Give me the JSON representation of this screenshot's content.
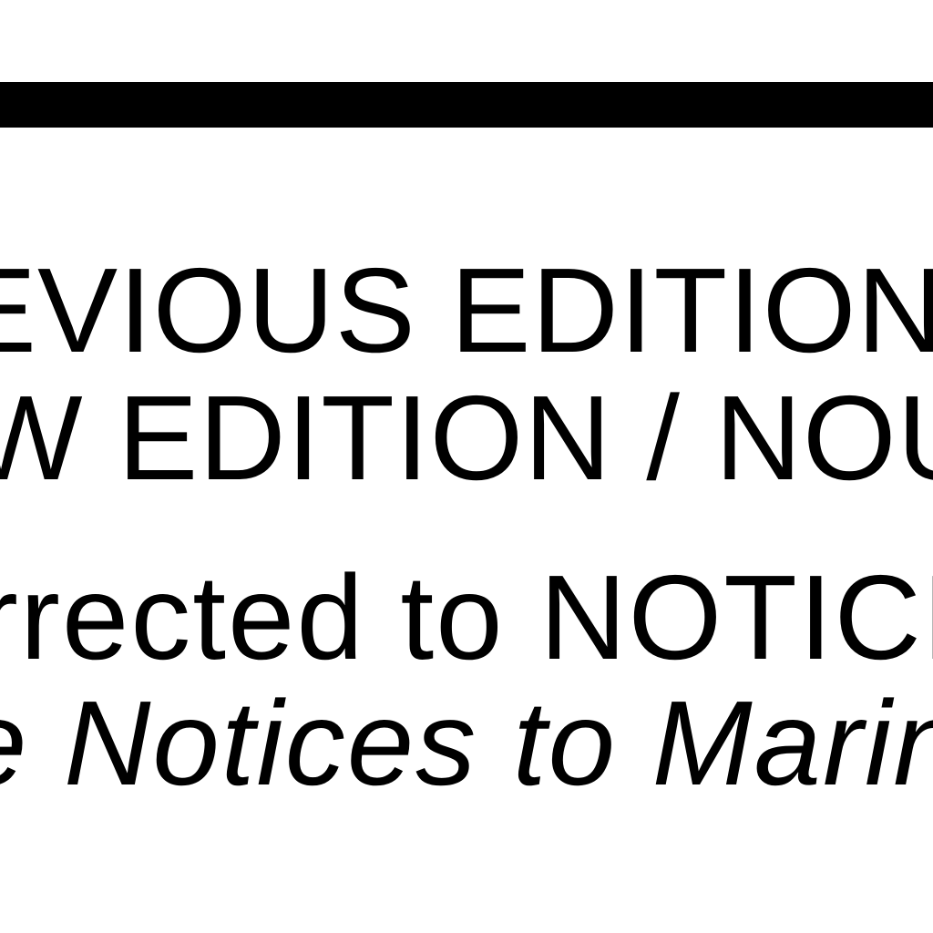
{
  "document": {
    "line1": "EVIOUS EDITIONS",
    "line2": "W EDITION / NOUV",
    "line3": "rrected to NOTICE",
    "line4": "e Notices to Marin"
  }
}
